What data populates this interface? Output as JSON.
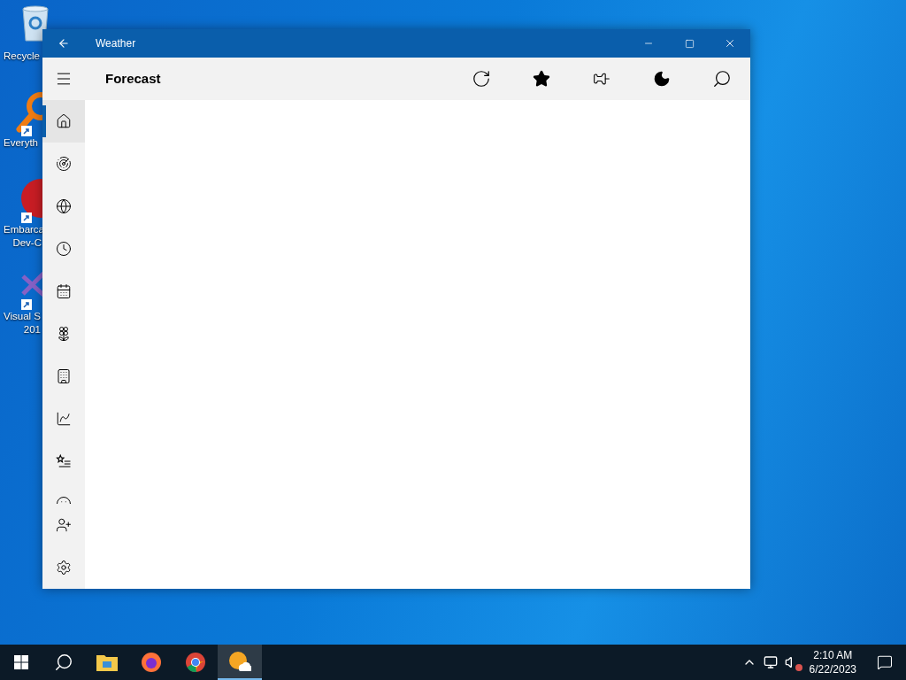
{
  "desktop_icons": [
    {
      "label": "Recycle"
    },
    {
      "label": "Everyth"
    },
    {
      "label": "Embarca\nDev-C"
    },
    {
      "label": "Visual S\n201"
    }
  ],
  "window": {
    "title": "Weather",
    "header": "Forecast"
  },
  "sidebar": {
    "items": [
      {
        "selected": true
      },
      {
        "selected": false
      },
      {
        "selected": false
      },
      {
        "selected": false
      },
      {
        "selected": false
      },
      {
        "selected": false
      },
      {
        "selected": false
      },
      {
        "selected": false
      },
      {
        "selected": false
      },
      {
        "selected": false
      }
    ],
    "footer": [
      {
        "selected": false
      },
      {
        "selected": false
      }
    ]
  },
  "taskbar": {
    "apps": [
      {
        "selected": false
      },
      {
        "selected": false
      },
      {
        "selected": false
      },
      {
        "selected": true
      }
    ],
    "time": "2:10 AM",
    "date": "6/22/2023"
  }
}
